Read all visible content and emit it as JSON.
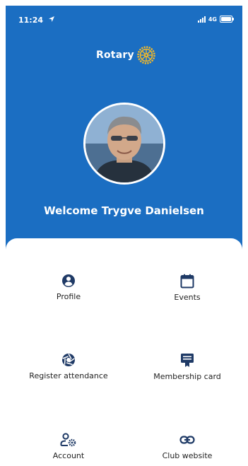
{
  "status_bar": {
    "time": "11:24",
    "network": "4G"
  },
  "brand": {
    "name": "Rotary"
  },
  "welcome": "Welcome Trygve Danielsen",
  "colors": {
    "header_bg": "#1b6ec2",
    "icon": "#1f3a66",
    "wheel": "#f2b92a"
  },
  "tiles": [
    {
      "label": "Profile",
      "icon": "user-circle-icon"
    },
    {
      "label": "Events",
      "icon": "calendar-icon"
    },
    {
      "label": "Register attendance",
      "icon": "aperture-icon"
    },
    {
      "label": "Membership card",
      "icon": "id-card-icon"
    },
    {
      "label": "Account",
      "icon": "user-settings-icon"
    },
    {
      "label": "Club website",
      "icon": "link-icon"
    }
  ]
}
